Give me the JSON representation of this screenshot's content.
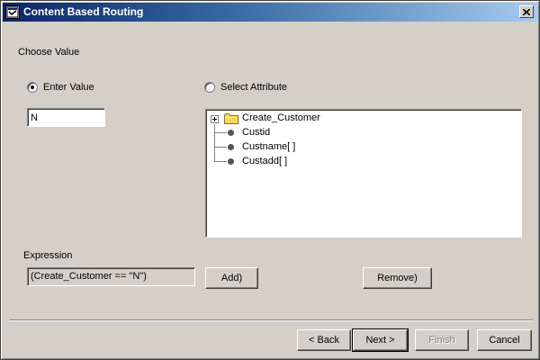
{
  "window": {
    "title": "Content Based Routing",
    "icon": "app-icon",
    "close_icon": "close-icon"
  },
  "choose_value": {
    "heading": "Choose Value",
    "enter_value": {
      "label": "Enter Value",
      "checked": true
    },
    "select_attribute": {
      "label": "Select Attribute",
      "checked": false
    },
    "value_input": "N"
  },
  "tree": {
    "root": {
      "label": "Create_Customer",
      "icon": "folder-icon",
      "expanded": true
    },
    "children": [
      {
        "label": "Custid",
        "icon": "leaf-dot-icon"
      },
      {
        "label": "Custname[ ]",
        "icon": "leaf-dot-icon"
      },
      {
        "label": "Custadd[ ]",
        "icon": "leaf-dot-icon"
      }
    ]
  },
  "expression": {
    "label": "Expression",
    "value": "(Create_Customer == \"N\")",
    "add_button": "Add)",
    "remove_button": "Remove)"
  },
  "footer": {
    "back": "< Back",
    "next": "Next >",
    "finish": "Finish",
    "cancel": "Cancel"
  },
  "colors": {
    "titlebar_start": "#0a246a",
    "titlebar_end": "#a6caf0",
    "dialog_face": "#d4d0c8",
    "folder_yellow": "#f5d75a"
  }
}
